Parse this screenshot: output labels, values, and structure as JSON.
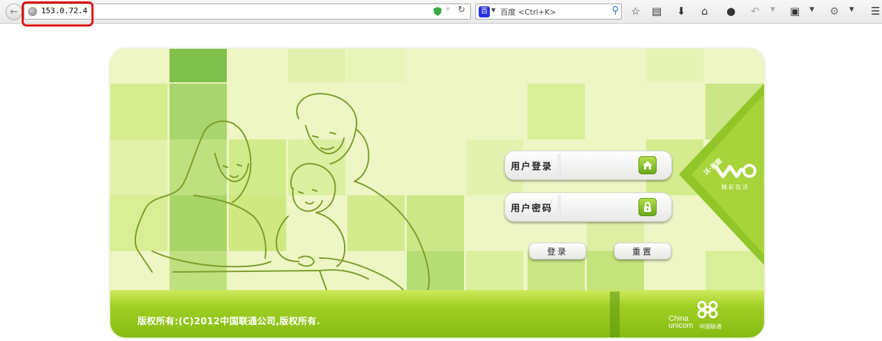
{
  "browser": {
    "url": "153.0.72.4",
    "search_engine_label": "百",
    "search_placeholder": "百度 <Ctrl+K>",
    "icons": [
      "back-icon",
      "globe-icon",
      "shield-icon",
      "dropdown-icon",
      "reload-icon",
      "search-icon",
      "star-icon",
      "bookmarks-icon",
      "download-icon",
      "home-icon",
      "chat-icon",
      "undo-icon",
      "crop-icon",
      "extension-icon",
      "menu-icon"
    ]
  },
  "login": {
    "username_label": "用户登录",
    "password_label": "用户密码",
    "username_value": "",
    "password_value": "",
    "login_button": "登录",
    "reset_button": "重置"
  },
  "branding": {
    "badge_text": "沃·家庭",
    "slogan": "精彩在沃",
    "logo_en_line1": "China",
    "logo_en_line2": "unicom",
    "logo_cn": "中国联通"
  },
  "footer": {
    "copyright": "版权所有:(C)2012中国联通公司,版权所有."
  },
  "colors": {
    "accent_green": "#86bb12",
    "url_highlight": "#e01010"
  }
}
